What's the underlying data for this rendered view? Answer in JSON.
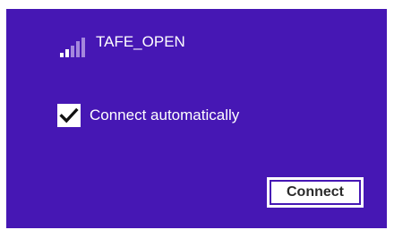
{
  "network": {
    "name": "TAFE_OPEN",
    "signal_icon": "wifi-signal-bars-icon",
    "signal_bars_total": 5,
    "signal_bars_lit": 2
  },
  "auto_connect": {
    "label": "Connect automatically",
    "checked": true,
    "check_icon": "checkmark-icon"
  },
  "actions": {
    "connect_label": "Connect"
  },
  "colors": {
    "panel_background": "#4617b4",
    "text": "#ffffff",
    "signal_dim": "#a487dd"
  }
}
